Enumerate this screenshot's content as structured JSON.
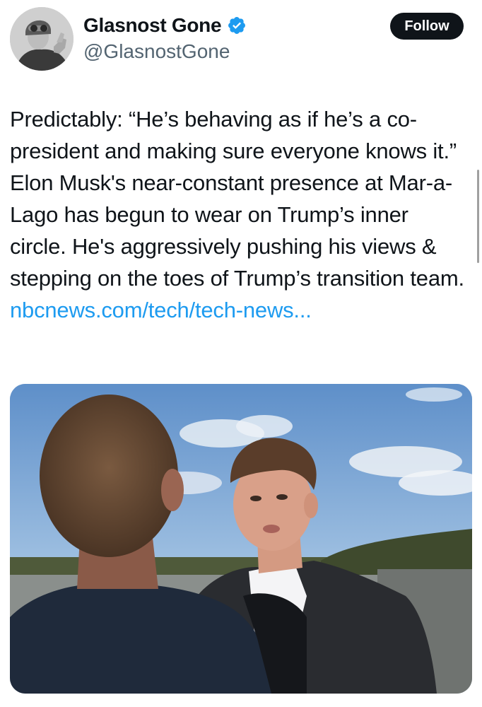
{
  "author": {
    "display_name": "Glasnost Gone",
    "handle": "@GlasnostGone",
    "verified": true
  },
  "actions": {
    "follow_label": "Follow"
  },
  "tweet": {
    "text": "Predictably: “He’s behaving as if he’s a co-president and making sure everyone knows it.” Elon Musk's near-constant presence at Mar-a-Lago has begun to wear on Trump’s inner circle. He's aggressively pushing his views & stepping on the toes of Trump’s transition team. ",
    "link_text": "nbcnews.com/tech/tech-news..."
  },
  "media": {
    "type": "photo"
  },
  "colors": {
    "text": "#0f1419",
    "secondary_text": "#536471",
    "link": "#1d9bf0",
    "verified_badge": "#1d9bf0",
    "follow_button_bg": "#0f1419",
    "follow_button_text": "#ffffff"
  },
  "icons": {
    "verified": "verified-badge-icon"
  }
}
